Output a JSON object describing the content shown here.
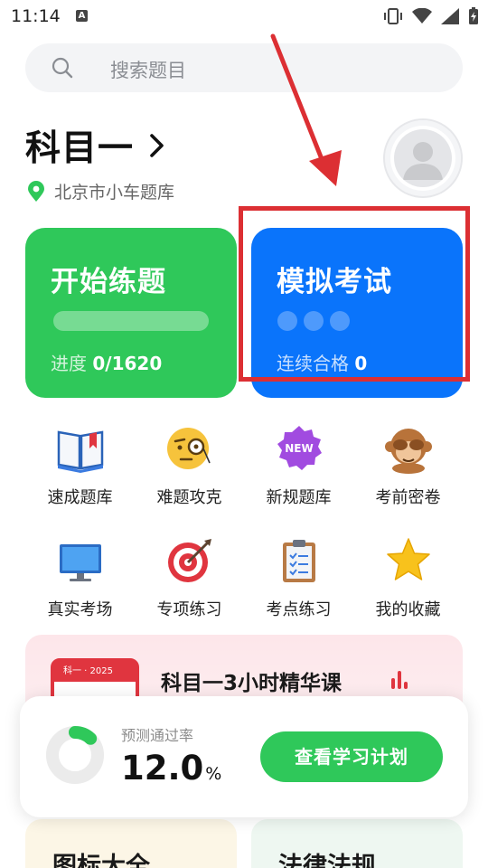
{
  "status_bar": {
    "time": "11:14",
    "notification_badge": "A",
    "icons": [
      "vibrate-icon",
      "wifi-icon",
      "signal-icon",
      "battery-charging-icon"
    ]
  },
  "search": {
    "placeholder": "搜索题目",
    "icon": "search-icon"
  },
  "subject": {
    "title": "科目一",
    "location": "北京市小车题库"
  },
  "cards": {
    "practice": {
      "title": "开始练题",
      "progress_label": "进度",
      "progress_value": "0/1620",
      "progress_fraction": 0,
      "color": "#2fc85a"
    },
    "exam": {
      "title": "模拟考试",
      "streak_label": "连续合格",
      "streak_value": "0",
      "streak_dots": 3,
      "color": "#0a74fb"
    }
  },
  "grid": [
    {
      "label": "速成题库",
      "icon": "open-book-icon"
    },
    {
      "label": "难题攻克",
      "icon": "monocle-face-icon"
    },
    {
      "label": "新规题库",
      "icon": "new-badge-icon"
    },
    {
      "label": "考前密卷",
      "icon": "see-no-evil-monkey-icon"
    },
    {
      "label": "真实考场",
      "icon": "monitor-icon"
    },
    {
      "label": "专项练习",
      "icon": "target-icon"
    },
    {
      "label": "考点练习",
      "icon": "clipboard-icon"
    },
    {
      "label": "我的收藏",
      "icon": "star-icon"
    }
  ],
  "course": {
    "title": "科目一3小时精华课",
    "book_label": "科一 · 2025"
  },
  "pass_rate": {
    "label": "预测通过率",
    "value": "12.0",
    "unit": "%",
    "button": "查看学习计划",
    "fraction": 0.12
  },
  "tiles": {
    "icons": "图标大全",
    "law": "法律法规"
  },
  "annotation": {
    "color": "#dc2f33"
  }
}
